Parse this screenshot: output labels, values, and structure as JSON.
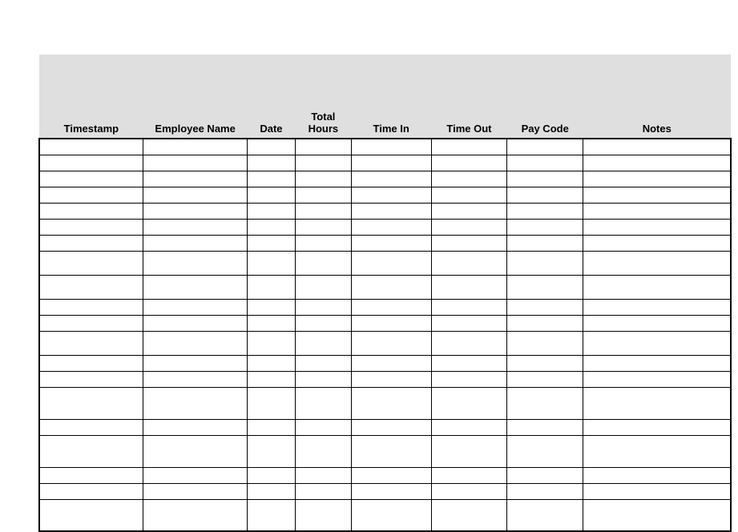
{
  "table": {
    "headers": {
      "timestamp": "Timestamp",
      "employee_name": "Employee Name",
      "date": "Date",
      "total_hours": "Total Hours",
      "time_in": "Time In",
      "time_out": "Time Out",
      "pay_code": "Pay Code",
      "notes": "Notes"
    },
    "rows": [
      {
        "timestamp": "",
        "employee_name": "",
        "date": "",
        "total_hours": "",
        "time_in": "",
        "time_out": "",
        "pay_code": "",
        "notes": ""
      },
      {
        "timestamp": "",
        "employee_name": "",
        "date": "",
        "total_hours": "",
        "time_in": "",
        "time_out": "",
        "pay_code": "",
        "notes": ""
      },
      {
        "timestamp": "",
        "employee_name": "",
        "date": "",
        "total_hours": "",
        "time_in": "",
        "time_out": "",
        "pay_code": "",
        "notes": ""
      },
      {
        "timestamp": "",
        "employee_name": "",
        "date": "",
        "total_hours": "",
        "time_in": "",
        "time_out": "",
        "pay_code": "",
        "notes": ""
      },
      {
        "timestamp": "",
        "employee_name": "",
        "date": "",
        "total_hours": "",
        "time_in": "",
        "time_out": "",
        "pay_code": "",
        "notes": ""
      },
      {
        "timestamp": "",
        "employee_name": "",
        "date": "",
        "total_hours": "",
        "time_in": "",
        "time_out": "",
        "pay_code": "",
        "notes": ""
      },
      {
        "timestamp": "",
        "employee_name": "",
        "date": "",
        "total_hours": "",
        "time_in": "",
        "time_out": "",
        "pay_code": "",
        "notes": ""
      },
      {
        "timestamp": "",
        "employee_name": "",
        "date": "",
        "total_hours": "",
        "time_in": "",
        "time_out": "",
        "pay_code": "",
        "notes": ""
      },
      {
        "timestamp": "",
        "employee_name": "",
        "date": "",
        "total_hours": "",
        "time_in": "",
        "time_out": "",
        "pay_code": "",
        "notes": ""
      },
      {
        "timestamp": "",
        "employee_name": "",
        "date": "",
        "total_hours": "",
        "time_in": "",
        "time_out": "",
        "pay_code": "",
        "notes": ""
      },
      {
        "timestamp": "",
        "employee_name": "",
        "date": "",
        "total_hours": "",
        "time_in": "",
        "time_out": "",
        "pay_code": "",
        "notes": ""
      },
      {
        "timestamp": "",
        "employee_name": "",
        "date": "",
        "total_hours": "",
        "time_in": "",
        "time_out": "",
        "pay_code": "",
        "notes": ""
      },
      {
        "timestamp": "",
        "employee_name": "",
        "date": "",
        "total_hours": "",
        "time_in": "",
        "time_out": "",
        "pay_code": "",
        "notes": ""
      },
      {
        "timestamp": "",
        "employee_name": "",
        "date": "",
        "total_hours": "",
        "time_in": "",
        "time_out": "",
        "pay_code": "",
        "notes": ""
      },
      {
        "timestamp": "",
        "employee_name": "",
        "date": "",
        "total_hours": "",
        "time_in": "",
        "time_out": "",
        "pay_code": "",
        "notes": ""
      },
      {
        "timestamp": "",
        "employee_name": "",
        "date": "",
        "total_hours": "",
        "time_in": "",
        "time_out": "",
        "pay_code": "",
        "notes": ""
      },
      {
        "timestamp": "",
        "employee_name": "",
        "date": "",
        "total_hours": "",
        "time_in": "",
        "time_out": "",
        "pay_code": "",
        "notes": ""
      },
      {
        "timestamp": "",
        "employee_name": "",
        "date": "",
        "total_hours": "",
        "time_in": "",
        "time_out": "",
        "pay_code": "",
        "notes": ""
      },
      {
        "timestamp": "",
        "employee_name": "",
        "date": "",
        "total_hours": "",
        "time_in": "",
        "time_out": "",
        "pay_code": "",
        "notes": ""
      },
      {
        "timestamp": "",
        "employee_name": "",
        "date": "",
        "total_hours": "",
        "time_in": "",
        "time_out": "",
        "pay_code": "",
        "notes": ""
      }
    ]
  }
}
